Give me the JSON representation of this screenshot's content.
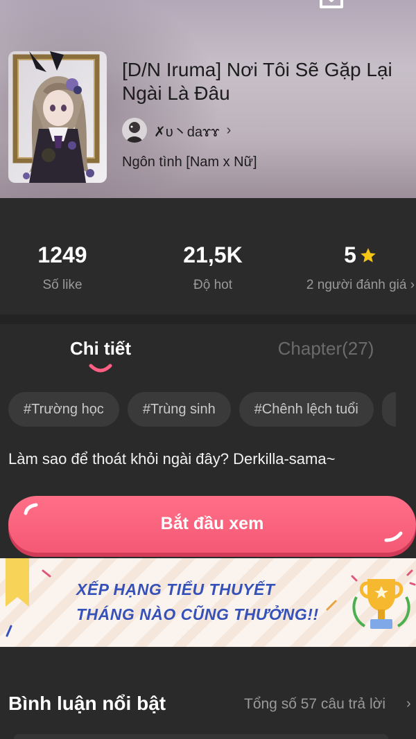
{
  "header": {
    "title": "[D/N Iruma] Nơi Tôi Sẽ Gặp Lại Ngài Là Đâu",
    "author": "✗υ丶daɤɤ",
    "genre": "Ngôn tình [Nam x Nữ]",
    "icons": [
      "download-icon",
      "more-icon",
      "chevron-right-icon"
    ]
  },
  "stats": {
    "likes": {
      "value": "1249",
      "label": "Số like"
    },
    "hot": {
      "value": "21,5K",
      "label": "Độ hot"
    },
    "rating": {
      "value": "5",
      "label": "2 người đánh giá ›",
      "icon": "star-icon",
      "star_color": "#f5c518"
    }
  },
  "tabs": [
    {
      "label": "Chi tiết",
      "active": true
    },
    {
      "label": "Chapter(27)",
      "active": false
    }
  ],
  "tags": [
    "#Trường học",
    "#Trùng sinh",
    "#Chênh lệch tuổi"
  ],
  "description": "Làm sao để thoát khỏi ngài đây? Derkilla-sama~",
  "start_button": {
    "label": "Bắt đầu xem",
    "color": "#f55874"
  },
  "banner": {
    "line1": "XẾP HẠNG TIỂU THUYẾT",
    "line2": "THÁNG NÀO CŨNG THƯỞNG!!",
    "text_color": "#3651b8"
  },
  "comments": {
    "title": "Bình luận nổi bật",
    "count": "Tổng số 57 câu trả lời",
    "chevron": "›"
  }
}
